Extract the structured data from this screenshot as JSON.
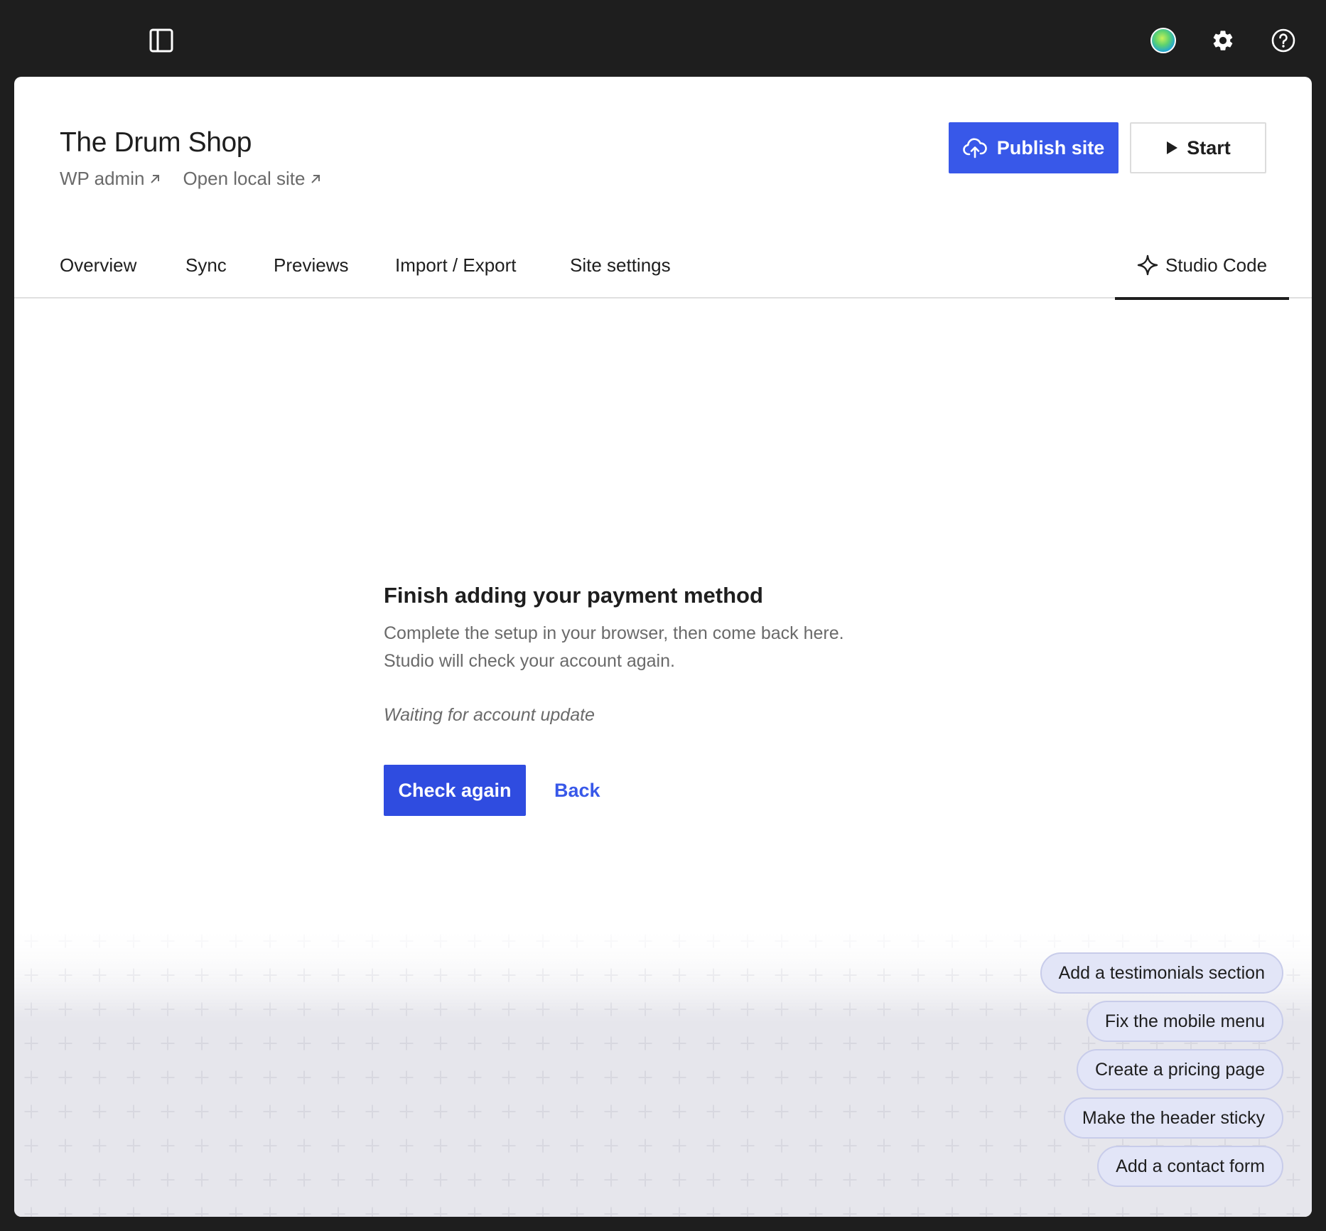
{
  "topbar": {
    "sidebar_icon": "sidebar-toggle-icon",
    "avatar_icon": "avatar",
    "settings_icon": "gear-icon",
    "help_icon": "help-icon"
  },
  "header": {
    "site_title": "The Drum Shop",
    "wp_admin_label": "WP admin",
    "open_local_site_label": "Open local site",
    "external_link_icon": "arrow-up-right-icon",
    "publish_label": "Publish site",
    "publish_icon": "cloud-upload-icon",
    "start_label": "Start",
    "start_icon": "play-icon"
  },
  "tabs": {
    "overview": "Overview",
    "sync": "Sync",
    "previews": "Previews",
    "import_export": "Import / Export",
    "site_settings": "Site settings",
    "studio_code": "Studio Code",
    "studio_code_icon": "sparkle-icon",
    "active": "Studio Code"
  },
  "main": {
    "heading": "Finish adding your payment method",
    "description": "Complete the setup in your browser, then come back here. Studio will check your account again.",
    "status": "Waiting for account update",
    "check_again_label": "Check again",
    "back_label": "Back"
  },
  "suggestions": [
    "Add a testimonials section",
    "Fix the mobile menu",
    "Create a pricing page",
    "Make the header sticky",
    "Add a contact form"
  ],
  "colors": {
    "accent": "#3858e9",
    "topbar_bg": "#1e1e1e",
    "chip_bg": "#e2e5f7"
  }
}
